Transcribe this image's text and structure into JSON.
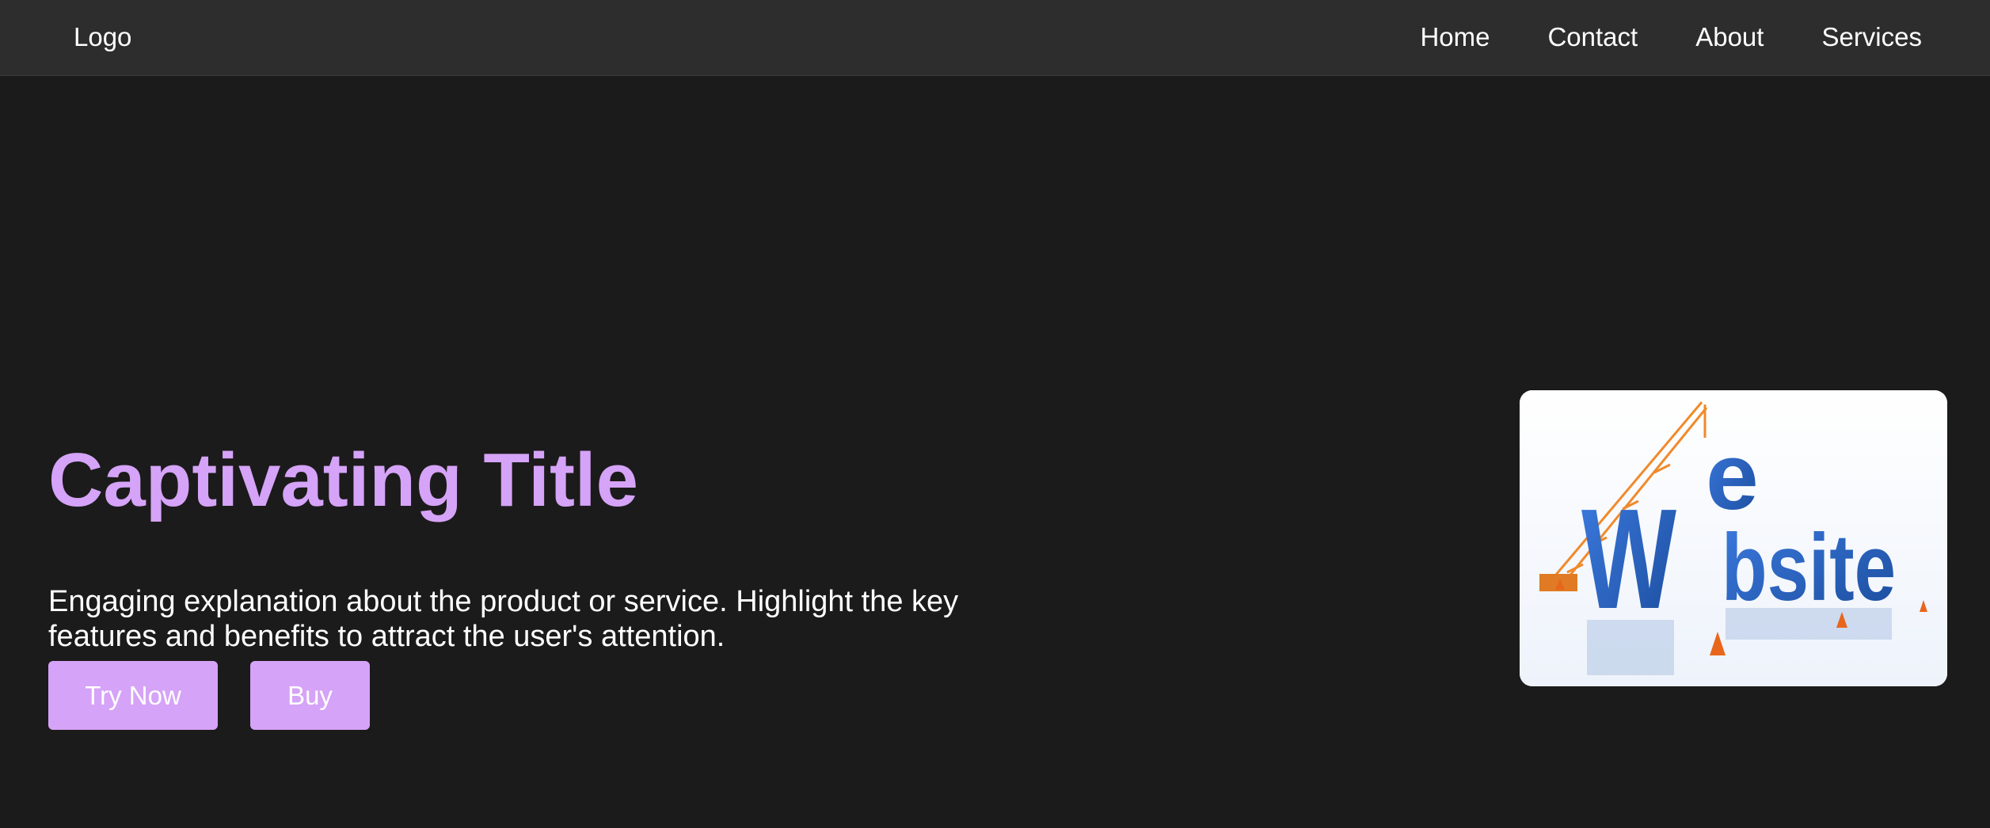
{
  "navbar": {
    "logo": "Logo",
    "links": [
      "Home",
      "Contact",
      "About",
      "Services"
    ]
  },
  "hero": {
    "title": "Captivating Title",
    "description": "Engaging explanation about the product or service. Highlight the key features and benefits to attract the user's attention.",
    "primary_button": "Try Now",
    "secondary_button": "Buy",
    "image_text": "Website"
  },
  "colors": {
    "background": "#1b1b1b",
    "navbar": "#2d2d2d",
    "accent": "#d5a3f7",
    "image_letters": "#2a62b8",
    "crane": "#f08a2c"
  }
}
